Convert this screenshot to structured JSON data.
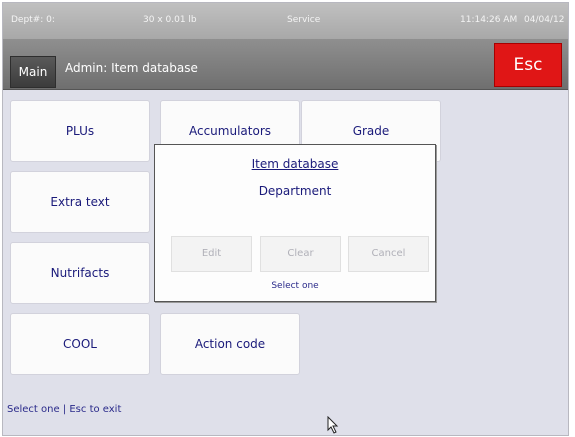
{
  "status_bar": {
    "dept": "Dept#: 0:",
    "weight": "30 x 0.01 lb",
    "mode": "Service",
    "time": "11:14:26 AM",
    "date": "04/04/12"
  },
  "title_bar": {
    "main_label": "Main",
    "title": "Admin: Item database",
    "esc_label": "Esc"
  },
  "tiles": {
    "plus": "PLUs",
    "accumulators": "Accumulators",
    "grade": "Grade",
    "extra_text": "Extra text",
    "nutrifacts": "Nutrifacts",
    "cool": "COOL",
    "action_code": "Action code"
  },
  "dialog": {
    "title": "Item database",
    "subtitle": "Department",
    "buttons": {
      "edit": "Edit",
      "clear": "Clear",
      "cancel": "Cancel"
    },
    "prompt": "Select one"
  },
  "footer": {
    "text": "Select one | Esc to exit"
  },
  "colors": {
    "esc_red": "#e01616",
    "text_navy": "#1a1a7a",
    "screen_bg": "#dfe0ea"
  },
  "icons": {
    "cursor": "mouse-pointer-icon"
  }
}
